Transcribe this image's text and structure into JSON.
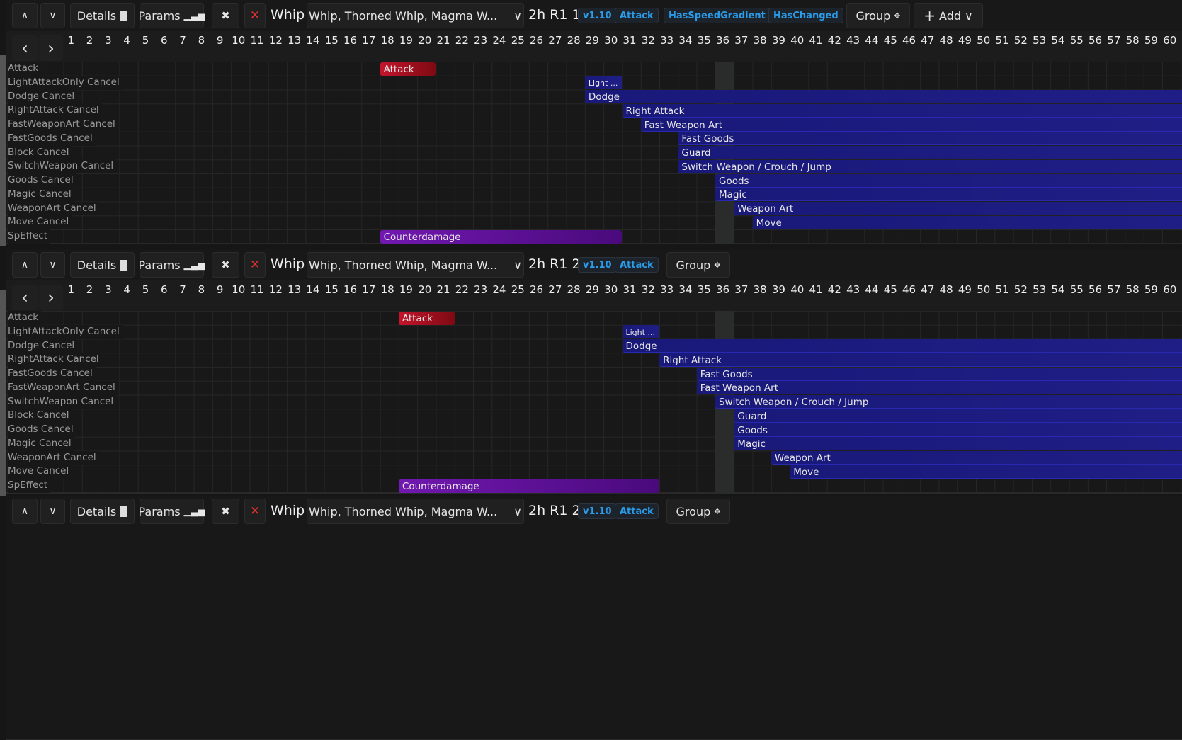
{
  "common": {
    "details_label": "Details",
    "params_label": "Params",
    "group_label": "Group",
    "add_label": "Add",
    "weapon_type": "Whip",
    "weapon_select": "Whip, Thorned Whip, Magma W...",
    "highlight_frame": 36,
    "frame_count": 61
  },
  "colors": {
    "badge_text": "#2a9be8",
    "cancel_bar": "#19197a",
    "attack_bar": "#c4142c",
    "speffect_bar": "#7118b0"
  },
  "panels": [
    {
      "title": "2h R1 1",
      "badges": [
        "v1.10",
        "Attack",
        "HasSpeedGradient",
        "HasChanged"
      ],
      "show_add": true,
      "rows": [
        "Attack",
        "LightAttackOnly Cancel",
        "Dodge Cancel",
        "RightAttack Cancel",
        "FastWeaponArt Cancel",
        "FastGoods Cancel",
        "Block Cancel",
        "SwitchWeapon Cancel",
        "Goods Cancel",
        "Magic Cancel",
        "WeaponArt Cancel",
        "Move Cancel",
        "SpEffect"
      ],
      "bars": [
        {
          "row": 0,
          "label": "Attack",
          "start": 18,
          "end": 20,
          "kind": "red"
        },
        {
          "row": 1,
          "label": "Light ...",
          "start": 29,
          "end": 30,
          "kind": "blue"
        },
        {
          "row": 2,
          "label": "Dodge",
          "start": 29,
          "end": null,
          "kind": "blue"
        },
        {
          "row": 3,
          "label": "Right Attack",
          "start": 31,
          "end": null,
          "kind": "blue"
        },
        {
          "row": 4,
          "label": "Fast Weapon Art",
          "start": 32,
          "end": null,
          "kind": "blue"
        },
        {
          "row": 5,
          "label": "Fast Goods",
          "start": 34,
          "end": null,
          "kind": "blue"
        },
        {
          "row": 6,
          "label": "Guard",
          "start": 34,
          "end": null,
          "kind": "blue"
        },
        {
          "row": 7,
          "label": "Switch Weapon / Crouch / Jump",
          "start": 34,
          "end": null,
          "kind": "blue"
        },
        {
          "row": 8,
          "label": "Goods",
          "start": 36,
          "end": null,
          "kind": "blue"
        },
        {
          "row": 9,
          "label": "Magic",
          "start": 36,
          "end": null,
          "kind": "blue"
        },
        {
          "row": 10,
          "label": "Weapon Art",
          "start": 37,
          "end": null,
          "kind": "blue"
        },
        {
          "row": 11,
          "label": "Move",
          "start": 38,
          "end": null,
          "kind": "blue"
        },
        {
          "row": 12,
          "label": "Counterdamage",
          "start": 18,
          "end": 30,
          "kind": "purple"
        }
      ]
    },
    {
      "title": "2h R1 2",
      "badges": [
        "v1.10",
        "Attack"
      ],
      "show_add": false,
      "rows": [
        "Attack",
        "LightAttackOnly Cancel",
        "Dodge Cancel",
        "RightAttack Cancel",
        "FastGoods Cancel",
        "FastWeaponArt Cancel",
        "SwitchWeapon Cancel",
        "Block Cancel",
        "Goods Cancel",
        "Magic Cancel",
        "WeaponArt Cancel",
        "Move Cancel",
        "SpEffect"
      ],
      "bars": [
        {
          "row": 0,
          "label": "Attack",
          "start": 19,
          "end": 21,
          "kind": "red"
        },
        {
          "row": 1,
          "label": "Light ...",
          "start": 31,
          "end": 32,
          "kind": "blue"
        },
        {
          "row": 2,
          "label": "Dodge",
          "start": 31,
          "end": null,
          "kind": "blue"
        },
        {
          "row": 3,
          "label": "Right Attack",
          "start": 33,
          "end": null,
          "kind": "blue"
        },
        {
          "row": 4,
          "label": "Fast Goods",
          "start": 35,
          "end": null,
          "kind": "blue"
        },
        {
          "row": 5,
          "label": "Fast Weapon Art",
          "start": 35,
          "end": null,
          "kind": "blue"
        },
        {
          "row": 6,
          "label": "Switch Weapon / Crouch / Jump",
          "start": 36,
          "end": null,
          "kind": "blue"
        },
        {
          "row": 7,
          "label": "Guard",
          "start": 37,
          "end": null,
          "kind": "blue"
        },
        {
          "row": 8,
          "label": "Goods",
          "start": 37,
          "end": null,
          "kind": "blue"
        },
        {
          "row": 9,
          "label": "Magic",
          "start": 37,
          "end": null,
          "kind": "blue"
        },
        {
          "row": 10,
          "label": "Weapon Art",
          "start": 39,
          "end": null,
          "kind": "blue"
        },
        {
          "row": 11,
          "label": "Move",
          "start": 40,
          "end": null,
          "kind": "blue"
        },
        {
          "row": 12,
          "label": "Counterdamage",
          "start": 19,
          "end": 32,
          "kind": "purple"
        }
      ]
    }
  ]
}
